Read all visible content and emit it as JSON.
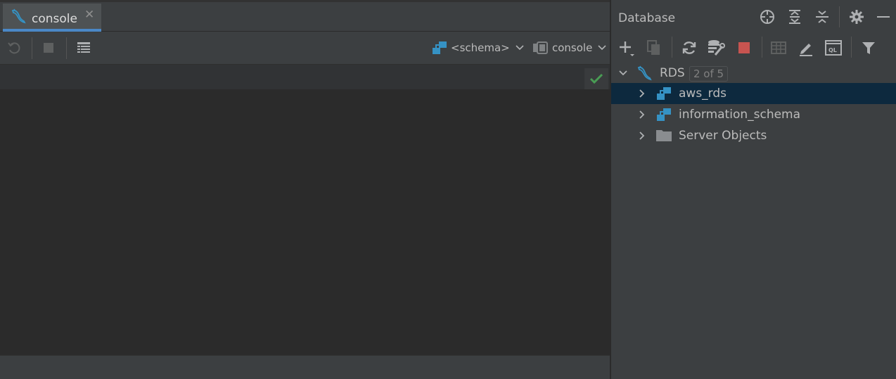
{
  "editor": {
    "tab": {
      "label": "console",
      "close_glyph": "✕",
      "icon": "mysql-dolphin-icon"
    },
    "toolbar": {
      "schema_combo": "<schema>",
      "console_combo": "console"
    }
  },
  "database": {
    "title": "Database",
    "tree": [
      {
        "label": "RDS",
        "badge": "2 of 5",
        "expanded": true,
        "icon": "mysql-dolphin-icon"
      },
      {
        "label": "aws_rds",
        "icon": "schema-icon",
        "selected": true
      },
      {
        "label": "information_schema",
        "icon": "schema-icon"
      },
      {
        "label": "Server Objects",
        "icon": "folder-icon"
      }
    ]
  },
  "colors": {
    "accent": "#4a88c7",
    "selection": "#0d293e",
    "stop_red": "#c75450",
    "ok_green": "#499c54",
    "schema_blue": "#3592c4"
  }
}
